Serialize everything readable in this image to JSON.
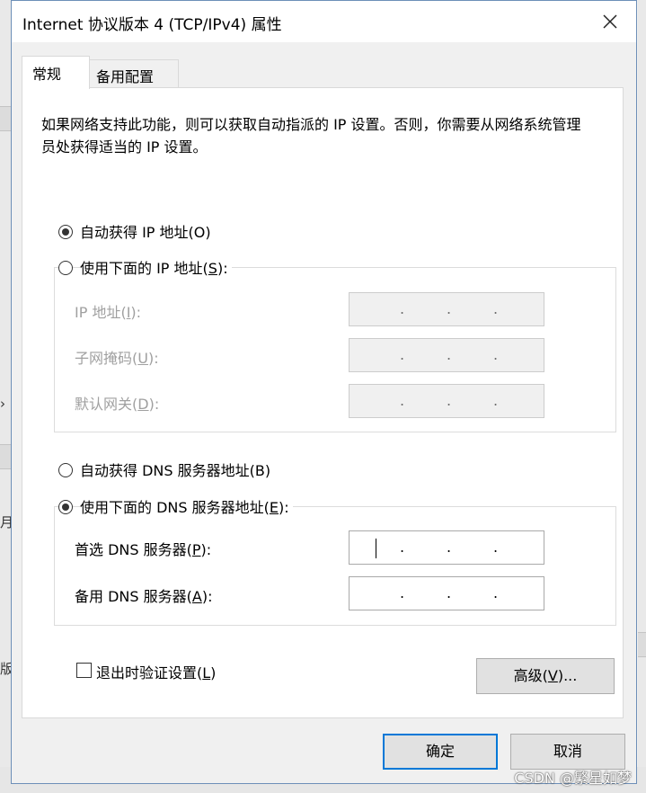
{
  "background_window": {
    "left_fragments": [
      "›",
      "月",
      "版"
    ]
  },
  "dialog": {
    "title": "Internet 协议版本 4 (TCP/IPv4) 属性",
    "close_glyph": "✕"
  },
  "tabs": [
    {
      "label": "常规",
      "active": true
    },
    {
      "label": "备用配置",
      "active": false
    }
  ],
  "description": "如果网络支持此功能，则可以获取自动指派的 IP 设置。否则，你需要从网络系统管理员处获得适当的 IP 设置。",
  "ip_section": {
    "auto_radio": {
      "text": "自动获得 IP 地址(",
      "key": "O",
      "end": ")",
      "checked": true
    },
    "manual_radio": {
      "text": "使用下面的 IP 地址(",
      "key": "S",
      "end": "):",
      "checked": false
    },
    "fields": [
      {
        "text": "IP 地址(",
        "key": "I",
        "end": "):",
        "value": ". . ."
      },
      {
        "text": "子网掩码(",
        "key": "U",
        "end": "):",
        "value": ". . ."
      },
      {
        "text": "默认网关(",
        "key": "D",
        "end": "):",
        "value": ". . ."
      }
    ]
  },
  "dns_section": {
    "auto_radio": {
      "text": "自动获得 DNS 服务器地址(B)",
      "checked": false
    },
    "manual_radio": {
      "text": "使用下面的 DNS 服务器地址(",
      "key": "E",
      "end": "):",
      "checked": true
    },
    "fields": [
      {
        "text": "首选 DNS 服务器(",
        "key": "P",
        "end": "):",
        "value": ". . ."
      },
      {
        "text": "备用 DNS 服务器(",
        "key": "A",
        "end": "):",
        "value": ". . ."
      }
    ]
  },
  "validate_checkbox": {
    "text": "退出时验证设置(",
    "key": "L",
    "end": ")",
    "checked": false
  },
  "buttons": {
    "advanced": {
      "text": "高级(",
      "key": "V",
      "end": ")..."
    },
    "ok": "确定",
    "cancel": "取消"
  },
  "watermark": "CSDN @繁星如梦"
}
